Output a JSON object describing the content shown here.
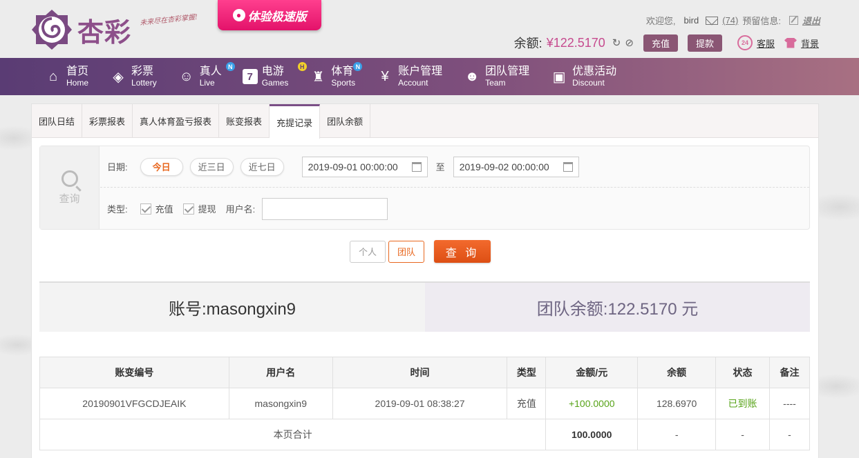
{
  "header": {
    "logo_text": "杏彩",
    "slogan": "未来尽在杏彩掌握!",
    "promo_label": "体验极速版",
    "welcome": "欢迎您,",
    "username": "bird",
    "message_count": "(74)",
    "reserve_info": "预留信息:",
    "logout": "退出",
    "balance_label": "余额:",
    "balance_amount": "¥122.5170",
    "recharge_button": "充值",
    "withdraw_button": "提款",
    "service_label": "客服",
    "background_label": "背景"
  },
  "nav": {
    "items": [
      {
        "cn": "首页",
        "en": "Home",
        "icon": "home-icon"
      },
      {
        "cn": "彩票",
        "en": "Lottery",
        "icon": "ticket-icon"
      },
      {
        "cn": "真人",
        "en": "Live",
        "icon": "live-dealer-icon",
        "badge": "N"
      },
      {
        "cn": "电游",
        "en": "Games",
        "icon": "slot-seven-icon",
        "badge": "H"
      },
      {
        "cn": "体育",
        "en": "Sports",
        "icon": "trophy-icon",
        "badge": "N"
      },
      {
        "cn": "账户管理",
        "en": "Account",
        "icon": "yen-coin-icon"
      },
      {
        "cn": "团队管理",
        "en": "Team",
        "icon": "team-icon"
      },
      {
        "cn": "优惠活动",
        "en": "Discount",
        "icon": "gift-icon"
      }
    ]
  },
  "tabs": [
    "团队日结",
    "彩票报表",
    "真人体育盈亏报表",
    "账变报表",
    "充提记录",
    "团队余额"
  ],
  "filter": {
    "search_label": "查询",
    "date_label": "日期:",
    "chips": [
      "今日",
      "近三日",
      "近七日"
    ],
    "date_from": "2019-09-01 00:00:00",
    "to_label": "至",
    "date_to": "2019-09-02 00:00:00",
    "type_label": "类型:",
    "type_recharge": "充值",
    "type_withdraw": "提现",
    "username_label": "用户名:",
    "username_value": ""
  },
  "actions": {
    "personal": "个人",
    "team": "团队",
    "query": "查 询"
  },
  "summary": {
    "account": "账号:masongxin9",
    "team_balance": "团队余额:122.5170 元"
  },
  "table": {
    "headers": [
      "账变编号",
      "用户名",
      "时间",
      "类型",
      "金额/元",
      "余额",
      "状态",
      "备注"
    ],
    "rows": [
      [
        "20190901VFGCDJEAIK",
        "masongxin9",
        "2019-09-01 08:38:27",
        "充值",
        "+100.0000",
        "128.6970",
        "已到账",
        "----"
      ]
    ],
    "total_label": "本页合计",
    "total_amount": "100.0000",
    "total_dash": "-"
  }
}
